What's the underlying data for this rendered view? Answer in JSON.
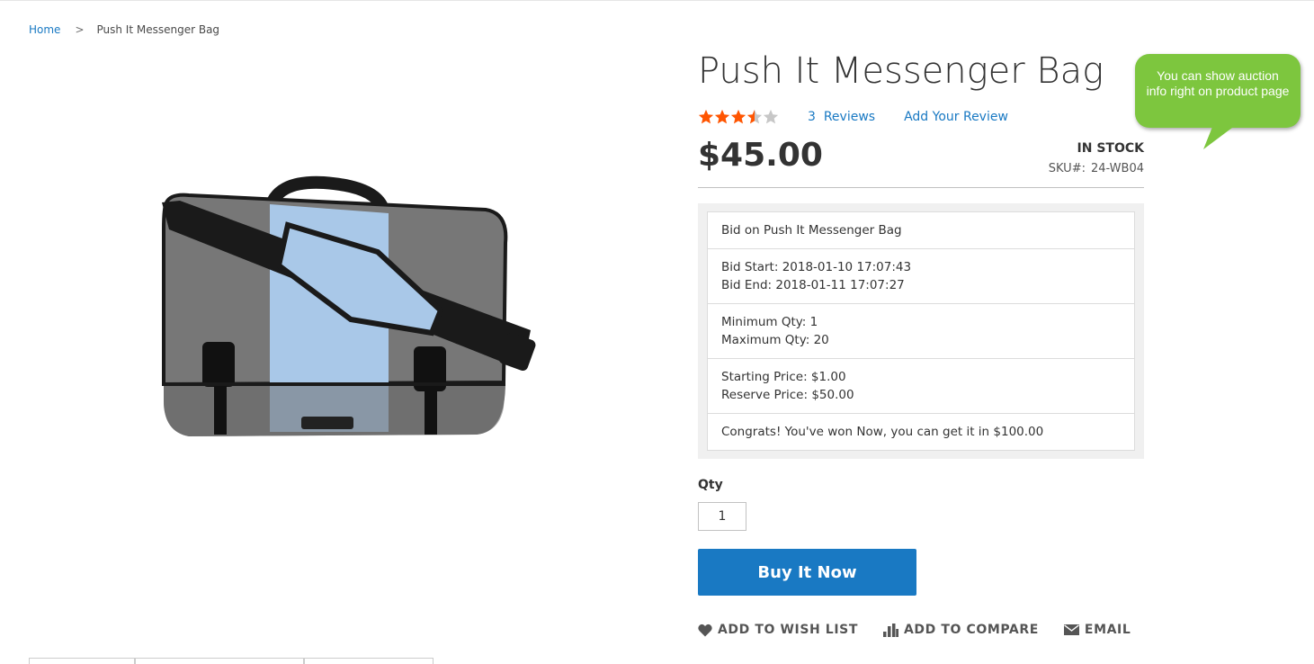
{
  "breadcrumb": {
    "home": "Home",
    "separator": ">",
    "current": "Push It Messenger Bag"
  },
  "product": {
    "title": "Push It Messenger Bag",
    "rating_stars": 3.5,
    "rating_max": 5,
    "reviews_count": "3",
    "reviews_label": "Reviews",
    "add_review": "Add Your Review",
    "price": "$45.00",
    "stock": "IN STOCK",
    "sku_label": "SKU#:",
    "sku": "24-WB04",
    "image_icon": "messenger-bag-image",
    "bag_colors": {
      "body": "#6f6f6f",
      "stripe": "#a9c8e8",
      "strap": "#1a1a1a"
    }
  },
  "auction": {
    "heading": "Bid on Push It Messenger Bag",
    "bid_start": "Bid Start: 2018-01-10 17:07:43",
    "bid_end": "Bid End: 2018-01-11 17:07:27",
    "min_qty": "Minimum Qty: 1",
    "max_qty": "Maximum Qty: 20",
    "starting_price": "Starting Price: $1.00",
    "reserve_price": "Reserve Price: $50.00",
    "message": "Congrats! You've won Now, you can get it in $100.00"
  },
  "qty": {
    "label": "Qty",
    "value": "1"
  },
  "buy_button": "Buy It Now",
  "actions": {
    "wishlist": "Add to Wish List",
    "compare": "Add to Compare",
    "email": "Email"
  },
  "callout": {
    "text": "You can show auction info right on product page",
    "color": "#7dc63e"
  },
  "colors": {
    "accent": "#1979c3",
    "star": "#ff5501",
    "star_empty": "#c7c7c7"
  }
}
